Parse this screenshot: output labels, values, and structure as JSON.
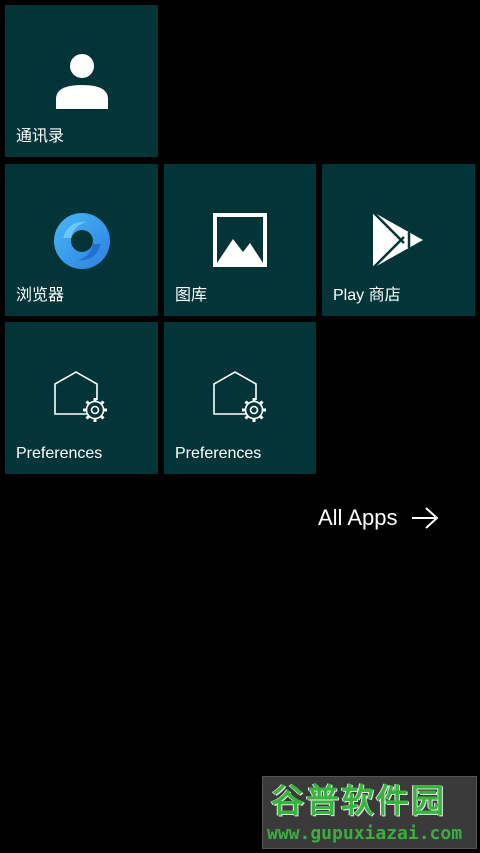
{
  "tiles": {
    "contacts": {
      "label": "通讯录",
      "icon": "contact-icon"
    },
    "browser": {
      "label": "浏览器",
      "icon": "browser-icon"
    },
    "gallery": {
      "label": "图库",
      "icon": "gallery-icon"
    },
    "play_store": {
      "label": "Play 商店",
      "icon": "play-store-icon"
    },
    "preferences_1": {
      "label": "Preferences",
      "icon": "home-settings-icon"
    },
    "preferences_2": {
      "label": "Preferences",
      "icon": "home-settings-icon"
    }
  },
  "all_apps": {
    "label": "All Apps",
    "icon": "arrow-right-icon"
  },
  "watermark": {
    "title": "谷普软件园",
    "url": "www.gupuxiazai.com"
  },
  "colors": {
    "background": "#000000",
    "tile": "#033437",
    "text": "#ffffff",
    "browser_ring": "#3aa3e8",
    "watermark_green": "#35b53b"
  }
}
